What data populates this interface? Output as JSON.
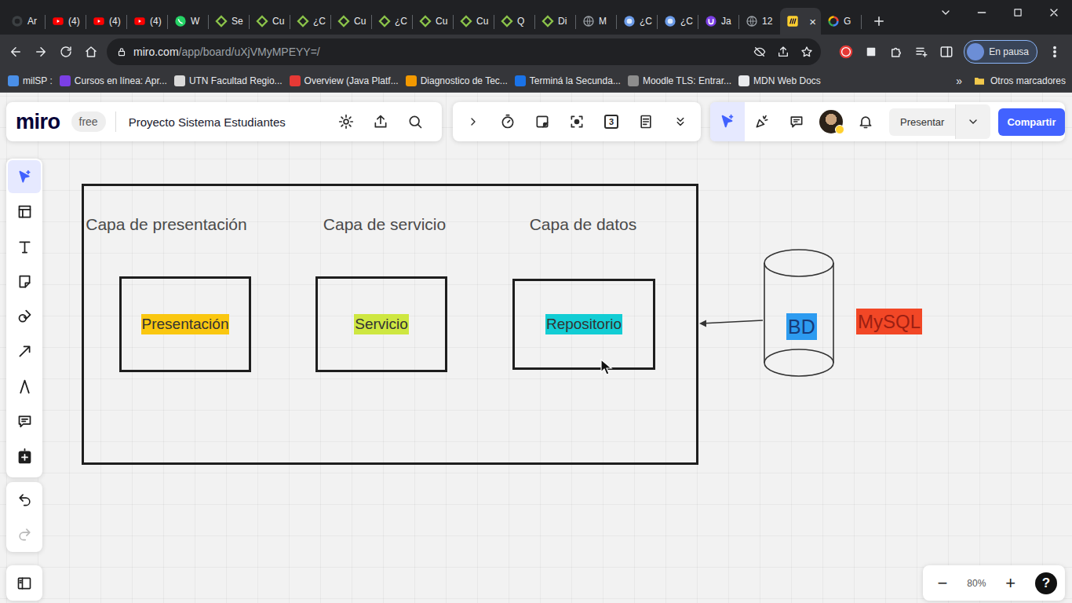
{
  "browser": {
    "tabs": [
      {
        "label": "Ar",
        "kind": "github",
        "selected": false
      },
      {
        "label": "(4)",
        "kind": "youtube",
        "selected": false
      },
      {
        "label": "(4)",
        "kind": "youtube",
        "selected": false
      },
      {
        "label": "(4)",
        "kind": "youtube",
        "selected": false
      },
      {
        "label": "W",
        "kind": "whatsapp",
        "selected": false
      },
      {
        "label": "Se",
        "kind": "diamond",
        "selected": false
      },
      {
        "label": "Cu",
        "kind": "diamond",
        "selected": false
      },
      {
        "label": "¿C",
        "kind": "diamond",
        "selected": false
      },
      {
        "label": "Cu",
        "kind": "diamond",
        "selected": false
      },
      {
        "label": "¿C",
        "kind": "diamond",
        "selected": false
      },
      {
        "label": "Cu",
        "kind": "diamond",
        "selected": false
      },
      {
        "label": "Cu",
        "kind": "diamond",
        "selected": false
      },
      {
        "label": "Q",
        "kind": "diamond",
        "selected": false
      },
      {
        "label": "Di",
        "kind": "diamond",
        "selected": false
      },
      {
        "label": "M",
        "kind": "globe",
        "selected": false
      },
      {
        "label": "¿C",
        "kind": "edge",
        "selected": false
      },
      {
        "label": "¿C",
        "kind": "edge",
        "selected": false
      },
      {
        "label": "Ja",
        "kind": "udemy",
        "selected": false
      },
      {
        "label": "12",
        "kind": "globe",
        "selected": false
      },
      {
        "kind": "miro",
        "selected": true,
        "close": "×"
      },
      {
        "label": "G",
        "kind": "google",
        "selected": false
      }
    ],
    "address": {
      "host": "miro.com",
      "path": "/app/board/uXjVMyMPEYY=/"
    },
    "profile": {
      "status": "En pausa"
    },
    "bookmarks": [
      {
        "label": "milSP :",
        "color": "#4a8fe7"
      },
      {
        "label": "Cursos en línea: Apr...",
        "color": "#7b3fe4"
      },
      {
        "label": "UTN Facultad Regio...",
        "color": "#d9d9d9"
      },
      {
        "label": "Overview (Java Platf...",
        "color": "#e53935"
      },
      {
        "label": "Diagnostico de Tec...",
        "color": "#f29900"
      },
      {
        "label": "Terminá la Secunda...",
        "color": "#1a73e8"
      },
      {
        "label": "Moodle TLS: Entrar...",
        "color": "#8d8d8d"
      },
      {
        "label": "MDN Web Docs",
        "color": "#e8eaed"
      }
    ],
    "bookmarks_more": "»",
    "other_bookmarks": "Otros marcadores"
  },
  "miro": {
    "logo": "miro",
    "plan": "free",
    "board_title": "Proyecto Sistema Estudiantes",
    "toolbar_badge": "3",
    "present": "Presentar",
    "share": "Compartir",
    "tools": [
      {
        "kind": "select",
        "selected": true
      },
      {
        "kind": "frame",
        "selected": false
      },
      {
        "kind": "text",
        "selected": false
      },
      {
        "kind": "sticky",
        "selected": false
      },
      {
        "kind": "shapes",
        "selected": false
      },
      {
        "kind": "arrow",
        "selected": false
      },
      {
        "kind": "pen",
        "selected": false
      },
      {
        "kind": "comment",
        "selected": false
      },
      {
        "kind": "plusbox",
        "selected": false
      }
    ],
    "history": [
      {
        "kind": "undo",
        "disabled": false
      },
      {
        "kind": "redo",
        "disabled": true
      }
    ],
    "zoom": {
      "minus": "−",
      "level": "80%",
      "plus": "+",
      "help": "?"
    }
  },
  "diagram": {
    "layers": [
      {
        "title": "Capa de presentación",
        "component": "Presentación",
        "color": "#fac710"
      },
      {
        "title": "Capa de servicio",
        "component": "Servicio",
        "color": "#cee741"
      },
      {
        "title": "Capa de datos",
        "component": "Repositorio",
        "color": "#12cdd4"
      }
    ],
    "database": {
      "label": "BD",
      "color": "#2d9bf0"
    },
    "technology": {
      "label": "MySQL",
      "color": "#f24726"
    }
  }
}
